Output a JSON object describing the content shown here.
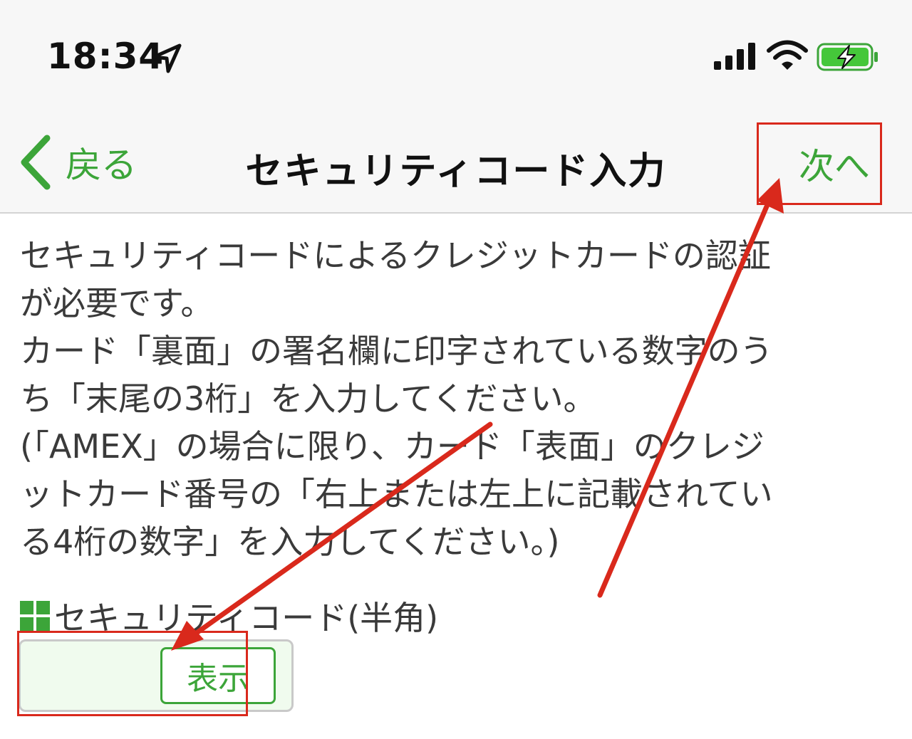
{
  "status_bar": {
    "time": "18:34"
  },
  "nav": {
    "back_label": "戻る",
    "title": "セキュリティコード入力",
    "next_label": "次へ"
  },
  "content": {
    "lines": [
      "セキュリティコードによるクレジットカードの認証",
      "が必要です。",
      "カード「裏面」の署名欄に印字されている数字のう",
      "ち「末尾の3桁」を入力してください。",
      "(「AMEX」の場合に限り、カード「表面」のクレジ",
      "ットカード番号の「右上または左上に記載されてい",
      "る4桁の数字」を入力してください。)"
    ]
  },
  "form": {
    "field_label": "セキュリティコード(半角)",
    "input_value": "",
    "input_placeholder": "",
    "show_label": "表示"
  },
  "colors": {
    "accent": "#3ca539",
    "annotation": "#d9291c",
    "bar_bg": "#f7f7f7",
    "input_bg": "#f0fbee"
  }
}
